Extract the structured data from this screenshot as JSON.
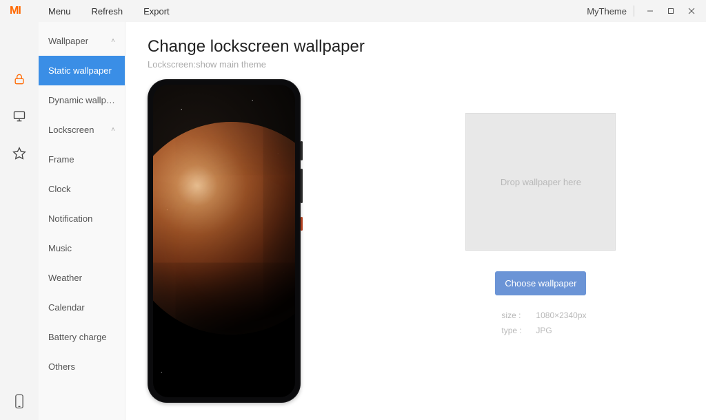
{
  "titlebar": {
    "logo_text": "MI",
    "menu": {
      "menu": "Menu",
      "refresh": "Refresh",
      "export": "Export"
    },
    "theme_name": "MyTheme"
  },
  "sidebar": {
    "groups": [
      {
        "label": "Wallpaper",
        "expanded": true,
        "items": [
          {
            "label": "Static wallpaper",
            "active": true
          },
          {
            "label": "Dynamic wallpap…",
            "active": false
          }
        ]
      },
      {
        "label": "Lockscreen",
        "expanded": true,
        "items": [
          {
            "label": "Frame"
          },
          {
            "label": "Clock"
          },
          {
            "label": "Notification"
          },
          {
            "label": "Music"
          },
          {
            "label": "Weather"
          },
          {
            "label": "Calendar"
          },
          {
            "label": "Battery charge"
          },
          {
            "label": "Others"
          }
        ]
      }
    ]
  },
  "main": {
    "title": "Change lockscreen wallpaper",
    "subtitle": "Lockscreen:show main theme",
    "dropzone_text": "Drop wallpaper here",
    "choose_button": "Choose wallpaper",
    "meta": {
      "size_label": "size :",
      "size_value": "1080×2340px",
      "type_label": "type :",
      "type_value": "JPG"
    }
  }
}
